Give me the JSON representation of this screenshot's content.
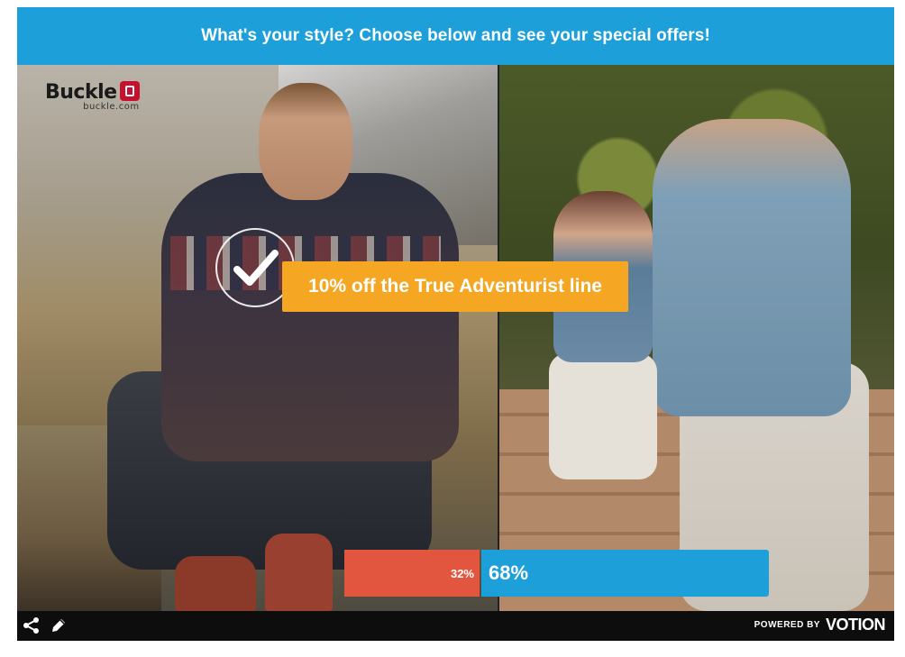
{
  "poll": {
    "question": "What's your style? Choose below and see your special offers!",
    "offer_label": "10% off the True Adventurist line",
    "results": {
      "left_percent": "32%",
      "right_percent": "68%",
      "left_value": 32,
      "right_value": 68
    }
  },
  "brand": {
    "name": "Buckle",
    "domain": "buckle.com"
  },
  "footer": {
    "powered_by": "POWERED BY",
    "brand": "VOTION"
  },
  "colors": {
    "header": "#1d9fd9",
    "offer": "#f5a623",
    "left_result": "#e2553f",
    "right_result": "#1d9fd9"
  },
  "icons": {
    "share": "share-icon",
    "edit": "pencil-icon",
    "check": "check-icon"
  }
}
